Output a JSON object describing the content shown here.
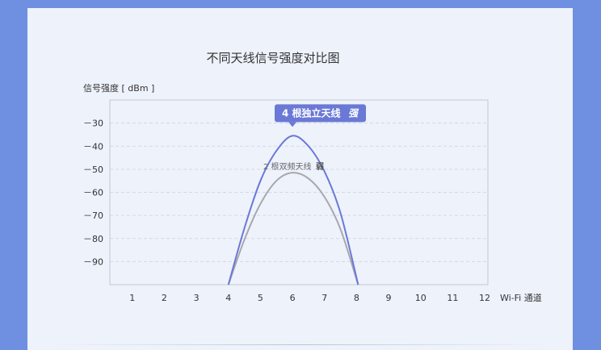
{
  "chart_data": {
    "type": "line",
    "title": "不同天线信号强度对比图",
    "ylabel": "信号强度 [ dBm ]",
    "xlabel": "Wi-Fi 通道",
    "x_ticks": [
      "1",
      "2",
      "3",
      "4",
      "5",
      "6",
      "7",
      "8",
      "9",
      "10",
      "11",
      "12"
    ],
    "y_ticks": [
      "－30",
      "－40",
      "－50",
      "－60",
      "－70",
      "－80",
      "－90"
    ],
    "xlim": [
      0.3,
      12.1
    ],
    "ylim": [
      -100,
      -20
    ],
    "grid": true,
    "series": [
      {
        "name": "4 根独立天线",
        "tag": "强",
        "color": "#6a78d6",
        "x": [
          4,
          4.5,
          5,
          5.5,
          6,
          6.5,
          7,
          7.5,
          8.05
        ],
        "y": [
          -100,
          -75.5,
          -55,
          -42,
          -35.5,
          -40,
          -51,
          -69,
          -100
        ]
      },
      {
        "name": "2 根双频天线",
        "tag": "弱",
        "color": "#a8a8ac",
        "x": [
          4,
          4.5,
          5,
          5.5,
          6,
          6.5,
          7,
          7.5,
          8.05
        ],
        "y": [
          -100,
          -80.5,
          -65,
          -55,
          -51.5,
          -54,
          -62,
          -76,
          -100
        ]
      }
    ]
  },
  "colors": {
    "page_bg": "#6f8fe0",
    "card_bg": "#eef2fb",
    "callout_bg": "#6a78d6"
  }
}
